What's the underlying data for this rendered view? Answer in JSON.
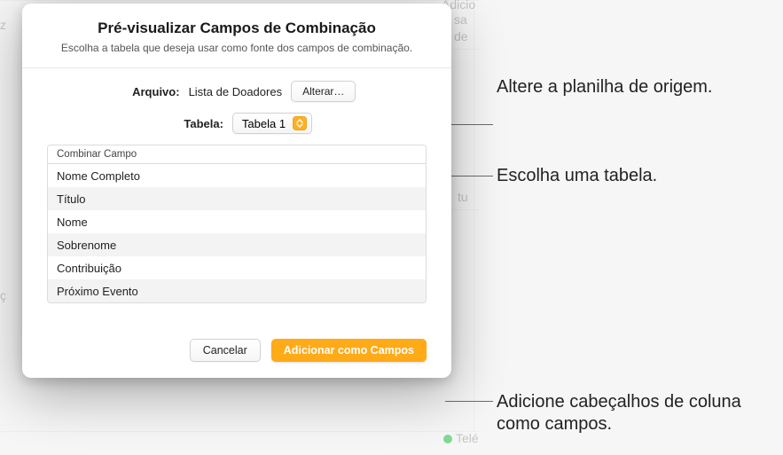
{
  "dialog": {
    "title": "Pré-visualizar Campos de Combinação",
    "subtitle": "Escolha a tabela que deseja usar como fonte dos campos de combinação.",
    "file_label": "Arquivo:",
    "file_value": "Lista de Doadores",
    "change_button": "Alterar…",
    "table_label": "Tabela:",
    "table_value": "Tabela 1",
    "list_header": "Combinar Campo",
    "rows": [
      "Nome Completo",
      "Título",
      "Nome",
      "Sobrenome",
      "Contribuição",
      "Próximo Evento"
    ],
    "cancel": "Cancelar",
    "add_fields": "Adicionar como Campos"
  },
  "callouts": {
    "change_source": "Altere a planilha de origem.",
    "choose_table": "Escolha uma tabela.",
    "add_headers": "Adicione cabeçalhos de coluna como campos."
  },
  "bg_words": {
    "a": "Adicio",
    "b": "sa",
    "c": "de",
    "d": "tu",
    "e": "Telé"
  }
}
